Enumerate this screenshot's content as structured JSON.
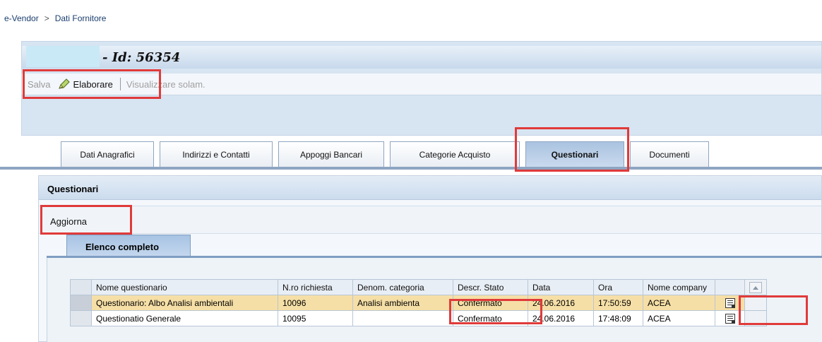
{
  "breadcrumb": {
    "root": "e-Vendor",
    "separator": ">",
    "current": "Dati Fornitore"
  },
  "header": {
    "title": "- Id: 56354"
  },
  "toolbar": {
    "save_label": "Salva",
    "edit_label": "Elaborare",
    "view_label": "Visualizzare solam."
  },
  "tabs": [
    {
      "label": "Dati Anagrafici"
    },
    {
      "label": "Indirizzi e Contatti"
    },
    {
      "label": "Appoggi Bancari"
    },
    {
      "label": "Categorie Acquisto"
    },
    {
      "label": "Questionari",
      "active": true
    },
    {
      "label": "Documenti"
    }
  ],
  "section": {
    "title": "Questionari",
    "refresh_label": "Aggiorna",
    "subtab_label": "Elenco completo"
  },
  "table": {
    "columns": [
      "Nome questionario",
      "N.ro richiesta",
      "Denom. categoria",
      "Descr. Stato",
      "Data",
      "Ora",
      "Nome company"
    ],
    "rows": [
      {
        "nome": "Questionario: Albo Analisi ambientali",
        "nr": "10096",
        "denom": "Analisi ambienta",
        "stato": "Confermato",
        "data": "24.06.2016",
        "ora": "17:50:59",
        "company": "ACEA",
        "highlighted": true
      },
      {
        "nome": "Questionatio Generale",
        "nr": "10095",
        "denom": "",
        "stato": "Confermato",
        "data": "24.06.2016",
        "ora": "17:48:09",
        "company": "ACEA",
        "highlighted": false
      }
    ]
  },
  "colors": {
    "highlight": "#f6dfa6",
    "annotation": "#e03a3a",
    "tab_active": "#aac3e0"
  }
}
